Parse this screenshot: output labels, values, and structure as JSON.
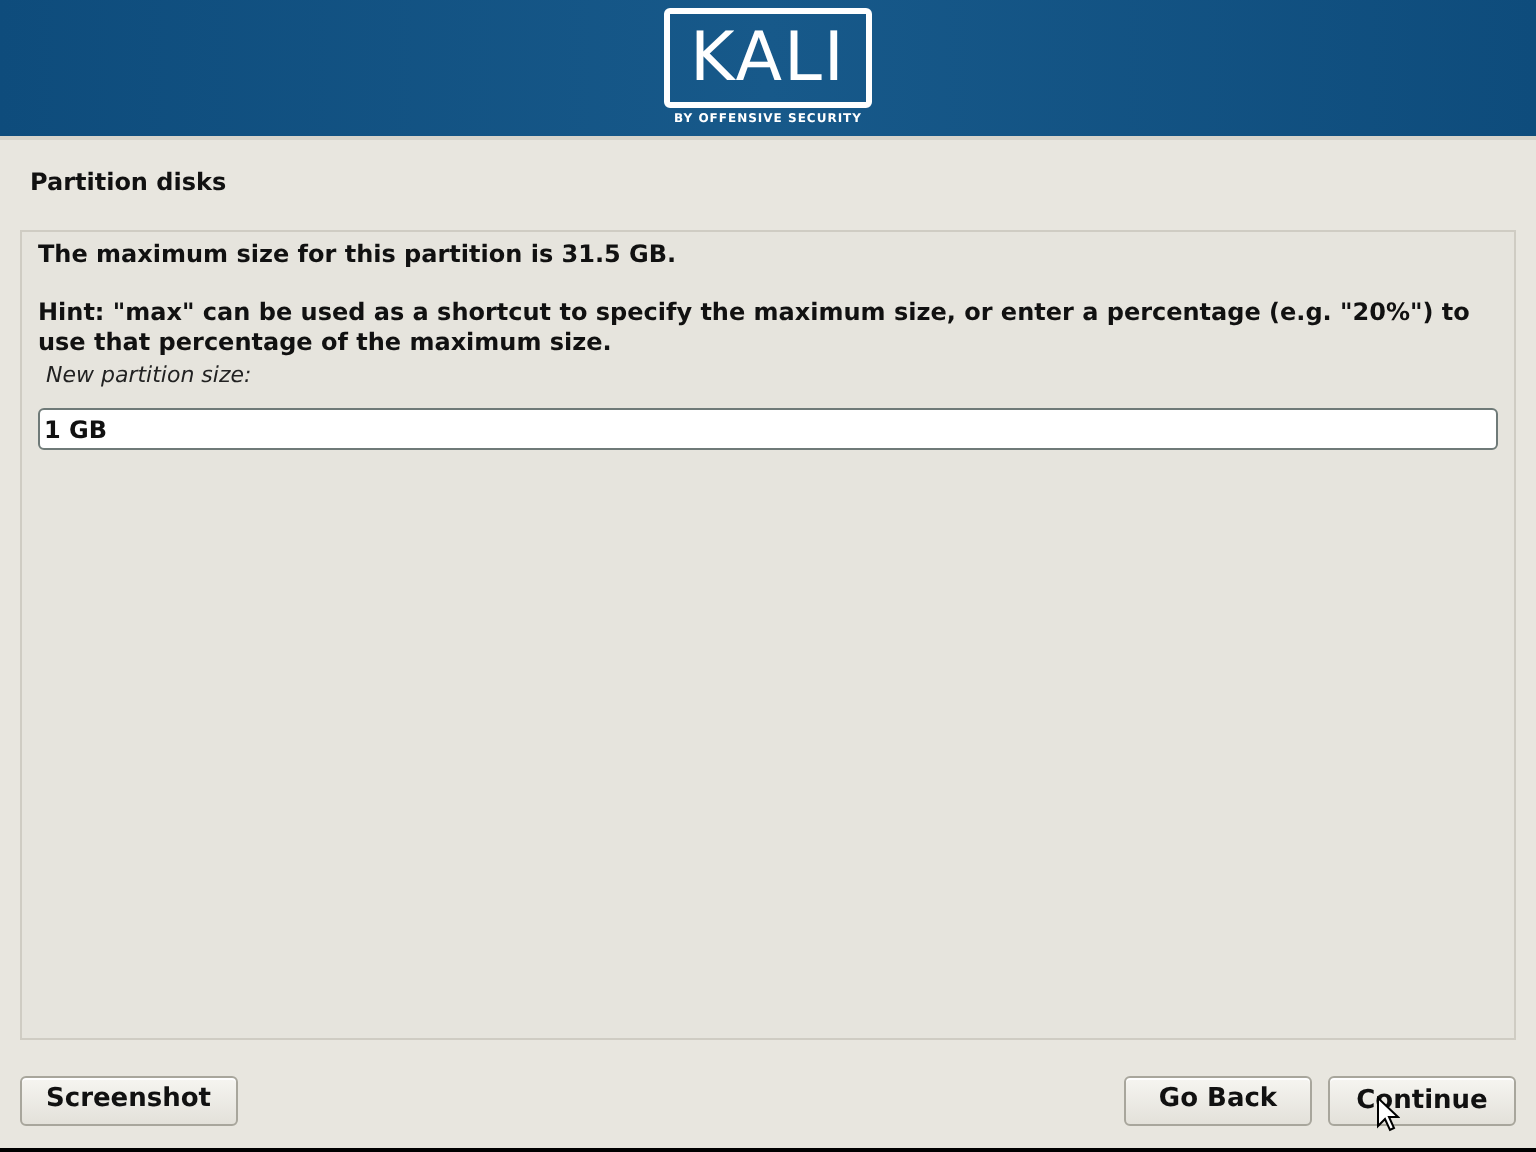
{
  "header": {
    "logo_text": "KALI",
    "logo_tagline": "BY OFFENSIVE SECURITY"
  },
  "title": "Partition disks",
  "panel": {
    "message": "The maximum size for this partition is 31.5 GB.",
    "hint": "Hint: \"max\" can be used as a shortcut to specify the maximum size, or enter a percentage (e.g. \"20%\") to use that percentage of the maximum size.",
    "field_label": "New partition size:",
    "field_value": "1 GB"
  },
  "buttons": [
    {
      "label": "Screenshot"
    },
    {
      "label": "Go Back"
    },
    {
      "label": "Continue"
    }
  ]
}
